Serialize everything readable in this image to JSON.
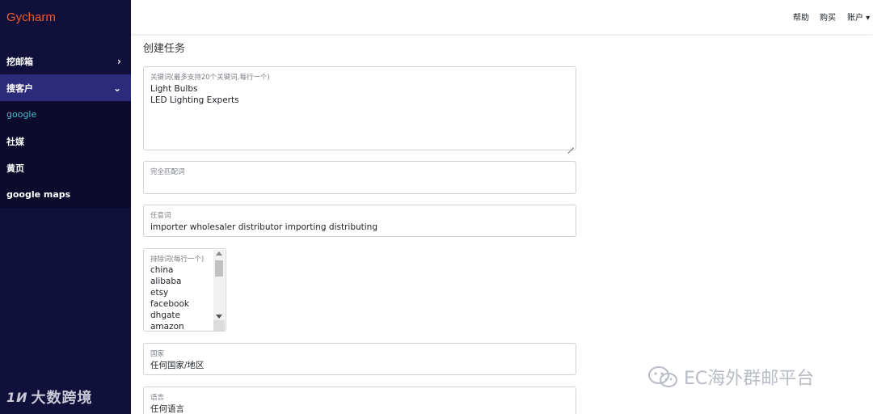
{
  "brand": "Gycharm",
  "sidebar": {
    "items": [
      {
        "label": "挖邮箱",
        "chevron": "›"
      },
      {
        "label": "搜客户",
        "chevron": "⌄"
      },
      {
        "label": "google"
      },
      {
        "label": "社媒"
      },
      {
        "label": "黄页"
      },
      {
        "label": "google maps"
      }
    ],
    "watermark": "大数跨境",
    "watermark_logo": "1Ͷ"
  },
  "topbar": {
    "help": "帮助",
    "buy": "购买",
    "account": "账户 ▾"
  },
  "main": {
    "title": "创建任务",
    "keywords": {
      "label": "关键词(最多支持20个关键词,每行一个)",
      "value": "Light Bulbs\nLED Lighting Experts"
    },
    "exact": {
      "label": "完全匹配词",
      "value": ""
    },
    "any": {
      "label": "任意词",
      "value": "importer wholesaler distributor importing distributing"
    },
    "exclude": {
      "label": "排除词(每行一个)",
      "items": [
        "china",
        "alibaba",
        "etsy",
        "facebook",
        "dhgate",
        "amazon"
      ]
    },
    "country": {
      "label": "国家",
      "value": "任何国家/地区"
    },
    "language": {
      "label": "语言",
      "value": "任何语言"
    }
  },
  "watermark": {
    "text": "EC海外群邮平台"
  },
  "colors": {
    "sidebar_bg": "#11103a",
    "active_bg": "#2c2a7a",
    "brand": "#f05a28",
    "current_item": "#3fc1c9"
  }
}
